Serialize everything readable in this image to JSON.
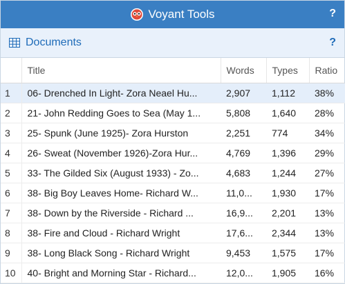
{
  "app": {
    "title": "Voyant Tools",
    "help": "?"
  },
  "panel": {
    "title": "Documents",
    "help": "?"
  },
  "columns": {
    "title": "Title",
    "words": "Words",
    "types": "Types",
    "ratio": "Ratio"
  },
  "rows": [
    {
      "n": "1",
      "title": "06- Drenched In Light- Zora Neael Hu...",
      "words": "2,907",
      "types": "1,112",
      "ratio": "38%"
    },
    {
      "n": "2",
      "title": "21- John Redding Goes to Sea (May 1...",
      "words": "5,808",
      "types": "1,640",
      "ratio": "28%"
    },
    {
      "n": "3",
      "title": "25- Spunk (June 1925)- Zora Hurston",
      "words": "2,251",
      "types": "774",
      "ratio": "34%"
    },
    {
      "n": "4",
      "title": "26- Sweat (November 1926)-Zora Hur...",
      "words": "4,769",
      "types": "1,396",
      "ratio": "29%"
    },
    {
      "n": "5",
      "title": "33- The Gilded Six (August 1933) - Zo...",
      "words": "4,683",
      "types": "1,244",
      "ratio": "27%"
    },
    {
      "n": "6",
      "title": "38- Big Boy Leaves Home- Richard W...",
      "words": "11,0...",
      "types": "1,930",
      "ratio": "17%"
    },
    {
      "n": "7",
      "title": "38- Down by the Riverside - Richard ...",
      "words": "16,9...",
      "types": "2,201",
      "ratio": "13%"
    },
    {
      "n": "8",
      "title": "38- Fire and Cloud - Richard Wright",
      "words": "17,6...",
      "types": "2,344",
      "ratio": "13%"
    },
    {
      "n": "9",
      "title": "38- Long Black Song - Richard Wright",
      "words": "9,453",
      "types": "1,575",
      "ratio": "17%"
    },
    {
      "n": "10",
      "title": "40- Bright and Morning Star - Richard...",
      "words": "12,0...",
      "types": "1,905",
      "ratio": "16%"
    }
  ],
  "selected_row": 0,
  "colors": {
    "titlebar": "#3a7fc3",
    "panel_header": "#e9f1fb",
    "accent": "#1e6bb8",
    "selected": "#e4eefa"
  },
  "icons": {
    "logo": "voyant-owl-icon",
    "panel": "grid-icon"
  }
}
